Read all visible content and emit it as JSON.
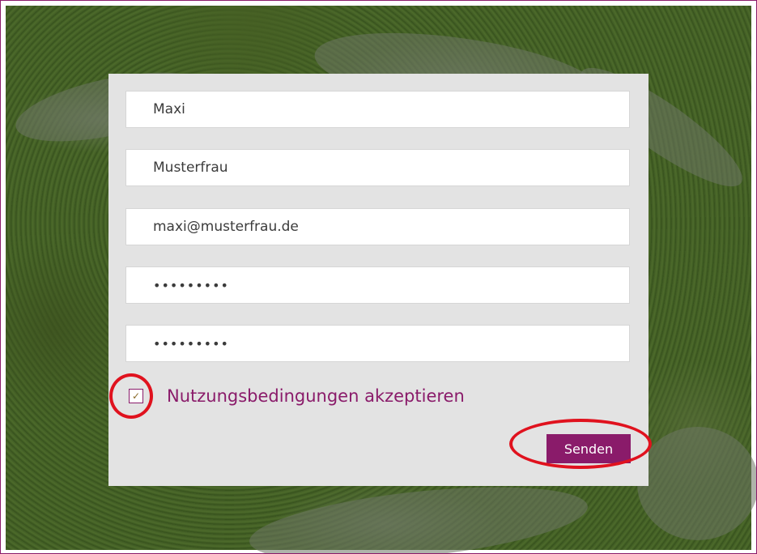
{
  "form": {
    "first_name": "Maxi",
    "last_name": "Musterfrau",
    "email": "maxi@musterfrau.de",
    "password": "•••••••••",
    "password_confirm": "•••••••••",
    "terms_label": "Nutzungsbedingungen akzeptieren",
    "terms_checked": true,
    "check_mark": "✓",
    "submit_label": "Senden"
  },
  "colors": {
    "accent": "#8a1b6a",
    "highlight_ring": "#e0121e",
    "panel": "#e3e3e3"
  }
}
